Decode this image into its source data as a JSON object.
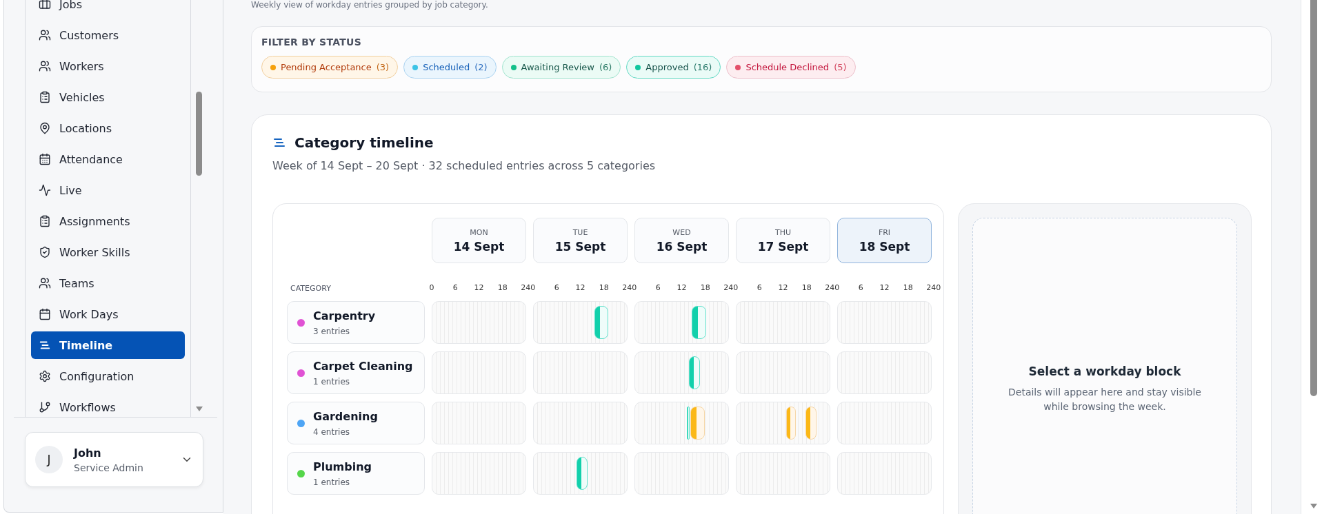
{
  "sidebar": {
    "items": [
      {
        "label": "Jobs",
        "selected": false
      },
      {
        "label": "Customers",
        "selected": false
      },
      {
        "label": "Workers",
        "selected": false
      },
      {
        "label": "Vehicles",
        "selected": false
      },
      {
        "label": "Locations",
        "selected": false
      },
      {
        "label": "Attendance",
        "selected": false
      },
      {
        "label": "Live",
        "selected": false
      },
      {
        "label": "Assignments",
        "selected": false
      },
      {
        "label": "Worker Skills",
        "selected": false
      },
      {
        "label": "Teams",
        "selected": false
      },
      {
        "label": "Work Days",
        "selected": false
      },
      {
        "label": "Timeline",
        "selected": true
      },
      {
        "label": "Configuration",
        "selected": false
      },
      {
        "label": "Workflows",
        "selected": false
      }
    ],
    "user": {
      "initial": "J",
      "name": "John",
      "role": "Service Admin"
    }
  },
  "page": {
    "subtitle": "Weekly view of workday entries grouped by job category."
  },
  "filter": {
    "title": "FILTER BY STATUS",
    "chips": [
      {
        "kind": "pending",
        "label": "Pending Acceptance",
        "count": "(3)",
        "color": "#f5a00b"
      },
      {
        "kind": "scheduled",
        "label": "Scheduled",
        "count": "(2)",
        "color": "#3cc3e6"
      },
      {
        "kind": "awaiting",
        "label": "Awaiting Review",
        "count": "(6)",
        "color": "#14c08a"
      },
      {
        "kind": "approved",
        "label": "Approved",
        "count": "(16)",
        "color": "#12c79f"
      },
      {
        "kind": "declined",
        "label": "Schedule Declined",
        "count": "(5)",
        "color": "#e4506a"
      }
    ]
  },
  "timeline": {
    "title": "Category timeline",
    "subtitle": "Week of 14 Sept – 20 Sept · 32 scheduled entries across 5 categories",
    "category_heading": "CATEGORY",
    "days": [
      {
        "weekday": "MON",
        "date": "14 Sept",
        "selected": false,
        "ticks": [
          "0",
          "6",
          "12",
          "18",
          "240"
        ]
      },
      {
        "weekday": "TUE",
        "date": "15 Sept",
        "selected": false,
        "ticks": [
          "6",
          "12",
          "18",
          "240"
        ]
      },
      {
        "weekday": "WED",
        "date": "16 Sept",
        "selected": false,
        "ticks": [
          "6",
          "12",
          "18",
          "240"
        ]
      },
      {
        "weekday": "THU",
        "date": "17 Sept",
        "selected": false,
        "ticks": [
          "6",
          "12",
          "18",
          "240"
        ]
      },
      {
        "weekday": "FRI",
        "date": "18 Sept",
        "selected": true,
        "ticks": [
          "6",
          "12",
          "18",
          "240"
        ]
      }
    ],
    "categories": [
      {
        "name": "Carpentry",
        "count": "3 entries",
        "color": "#e052d4",
        "entries": [
          {
            "kind": "approved"
          },
          {
            "kind": "approved"
          }
        ]
      },
      {
        "name": "Carpet Cleaning",
        "count": "1 entries",
        "color": "#e052d4",
        "entries": [
          {
            "kind": "approved"
          }
        ]
      },
      {
        "name": "Gardening",
        "count": "4 entries",
        "color": "#4ea5f5",
        "entries": [
          {
            "kind": "approved"
          },
          {
            "kind": "pending"
          },
          {
            "kind": "pending"
          },
          {
            "kind": "pending"
          }
        ]
      },
      {
        "name": "Plumbing",
        "count": "1 entries",
        "color": "#55d64a",
        "entries": [
          {
            "kind": "approved"
          }
        ]
      }
    ]
  },
  "details": {
    "title": "Select a workday block",
    "text": "Details will appear here and stay visible while browsing the week."
  }
}
